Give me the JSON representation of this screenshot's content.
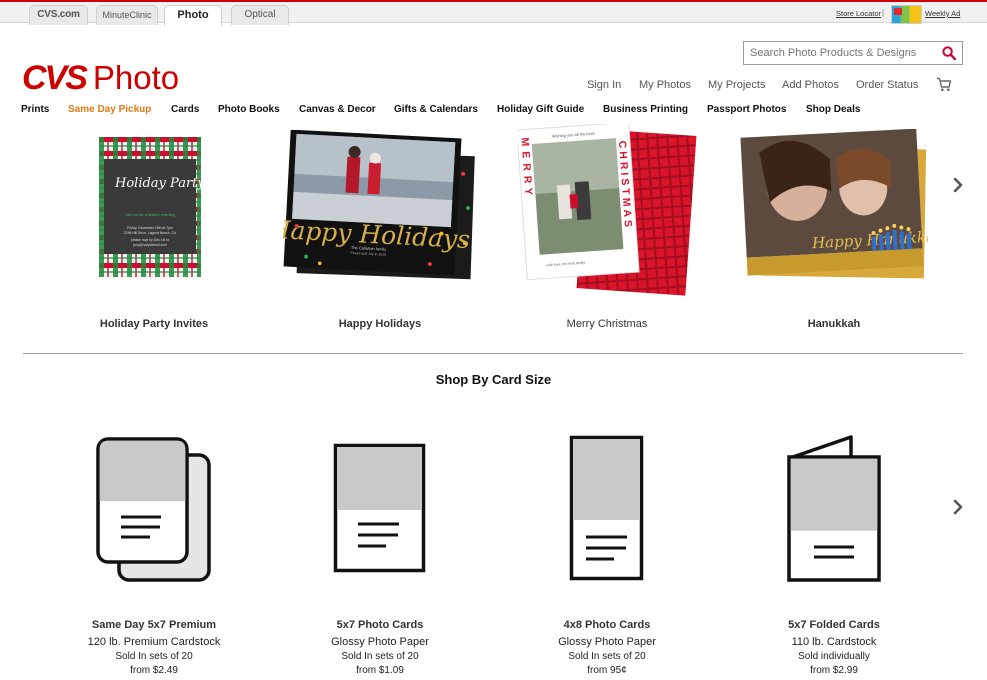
{
  "site_tabs": [
    "CVS.com",
    "MinuteClinic",
    "Photo",
    "Optical"
  ],
  "utility": {
    "store_locator": "Store Locator",
    "separator": "|",
    "weekly_ad": "Weekly Ad"
  },
  "logo": {
    "brand": "CVS",
    "product": "Photo"
  },
  "search": {
    "placeholder": "Search Photo Products & Designs",
    "icon": "search-icon"
  },
  "account_links": [
    "Sign In",
    "My Photos",
    "My Projects",
    "Add Photos",
    "Order Status"
  ],
  "nav": [
    "Prints",
    "Same Day Pickup",
    "Cards",
    "Photo Books",
    "Canvas & Decor",
    "Gifts & Calendars",
    "Holiday Gift Guide",
    "Business Printing",
    "Passport Photos",
    "Shop Deals"
  ],
  "nav_active": "Same Day Pickup",
  "holiday_cards": [
    {
      "title": "Holiday Party Invites",
      "card_text": {
        "script": "Holiday Party",
        "green": "Join us for a festive evening",
        "details": [
          "Friday, December 15th at 7pm",
          "2296 Hill Drive, Laguna Beach, CA",
          "please rsvp by Dec 1st to",
          "jocy@hollydemail.com"
        ]
      }
    },
    {
      "title": "Happy Holidays",
      "card_text": {
        "script": "Happy Holidays",
        "family": "The Callahan family",
        "greeting": "Peace and Joy in 2019"
      }
    },
    {
      "title": "Merry Christmas",
      "card_text": {
        "top": "Wishing you all the best.",
        "vertical_left": "MERRY",
        "vertical_right": "CHRISTMAS",
        "bottom": "with love, the Holt family"
      }
    },
    {
      "title": "Hanukkah",
      "card_text": {
        "script": "Happy Hanukkah"
      }
    }
  ],
  "section_title": "Shop By Card Size",
  "card_sizes": [
    {
      "name": "Same Day 5x7 Premium",
      "paper": "120 lb. Premium Cardstock",
      "sets": "Sold In sets of 20",
      "price": "from $2.49"
    },
    {
      "name": "5x7 Photo Cards",
      "paper": "Glossy Photo Paper",
      "sets": "Sold In sets of 20",
      "price": "from $1.09"
    },
    {
      "name": "4x8 Photo Cards",
      "paper": "Glossy Photo Paper",
      "sets": "Sold In sets of 20",
      "price": "from 95¢"
    },
    {
      "name": "5x7 Folded Cards",
      "paper": "110 lb. Cardstock",
      "sets": "Sold individually",
      "price": "from $2.99"
    }
  ],
  "colors": {
    "brand_red": "#cc0000",
    "active_nav": "#e07a10",
    "placeholder_gray": "#c9c9c9"
  }
}
